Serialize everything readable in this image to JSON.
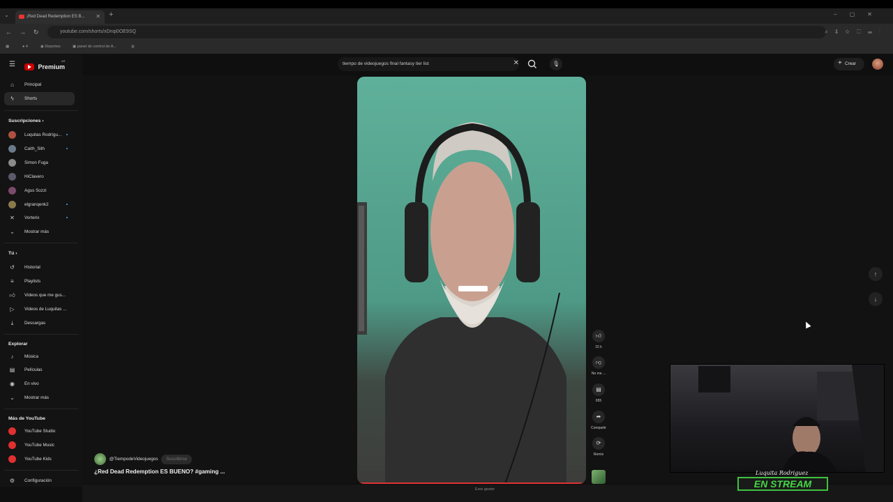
{
  "browser": {
    "tab_title": "¡Red Dead Redemption ES B...",
    "url": "youtube.com/shorts/xDnqi0OE9SQ",
    "bookmarks": [
      "4",
      "Deportes",
      "panel de control de A...",
      ""
    ]
  },
  "header": {
    "logo_text": "Premium",
    "logo_region": "AR",
    "search_query": "tiempo de videojuegos final fantasy tier list",
    "create_label": "Crear"
  },
  "sidebar": {
    "main_items": [
      {
        "label": "Principal",
        "icon": "home-icon"
      },
      {
        "label": "Shorts",
        "icon": "shorts-icon",
        "active": true
      }
    ],
    "subscriptions_title": "Suscripciones",
    "subscriptions": [
      {
        "label": "Luquitas Rodrígu...",
        "color": "#b05040",
        "new": true
      },
      {
        "label": "Caith_Sith",
        "color": "#6a7a8a",
        "new": true
      },
      {
        "label": "Simon Fuga",
        "color": "#8a8a8a",
        "new": false
      },
      {
        "label": "HiClavero",
        "color": "#5a5a6a",
        "new": false
      },
      {
        "label": "Agus Sozzi",
        "color": "#7a4a6a",
        "new": false
      },
      {
        "label": "elgranqenk2",
        "color": "#8a7a4a",
        "new": true
      },
      {
        "label": "Vorterix",
        "color": "#222222",
        "new": true
      }
    ],
    "subs_more": "Mostrar más",
    "you_title": "Tú",
    "you_items": [
      {
        "label": "Historial",
        "icon": "history-icon"
      },
      {
        "label": "Playlists",
        "icon": "playlist-icon"
      },
      {
        "label": "Videos que me gus...",
        "icon": "like-icon"
      },
      {
        "label": "Videos de Luquitas ...",
        "icon": "video-icon"
      },
      {
        "label": "Descargas",
        "icon": "download-icon"
      }
    ],
    "explore_title": "Explorar",
    "explore_items": [
      {
        "label": "Música",
        "icon": "music-icon"
      },
      {
        "label": "Películas",
        "icon": "film-icon"
      },
      {
        "label": "En vivo",
        "icon": "live-icon"
      },
      {
        "label": "Mostrar más",
        "icon": "chevron-down-icon"
      }
    ],
    "more_title": "Más de YouTube",
    "more_items": [
      {
        "label": "YouTube Studio"
      },
      {
        "label": "YouTube Music"
      },
      {
        "label": "YouTube Kids"
      }
    ],
    "settings": "Configuración"
  },
  "short": {
    "channel": "@TiempodeVideojuegos",
    "subscribe": "Suscribirse",
    "title": "¿Red Dead Redemption ES BUENO? #gaming ...",
    "likes": "15 k",
    "dislike_label": "No me ...",
    "comments": "655",
    "share_label": "Compartir",
    "remix_label": "Remix"
  },
  "status": {
    "text": "Eres gestor"
  },
  "overlay": {
    "name": "Luquita Rodriguez",
    "stream": "EN STREAM"
  },
  "colors": {
    "accent": "#ff0000",
    "stream_green": "#46d846"
  }
}
